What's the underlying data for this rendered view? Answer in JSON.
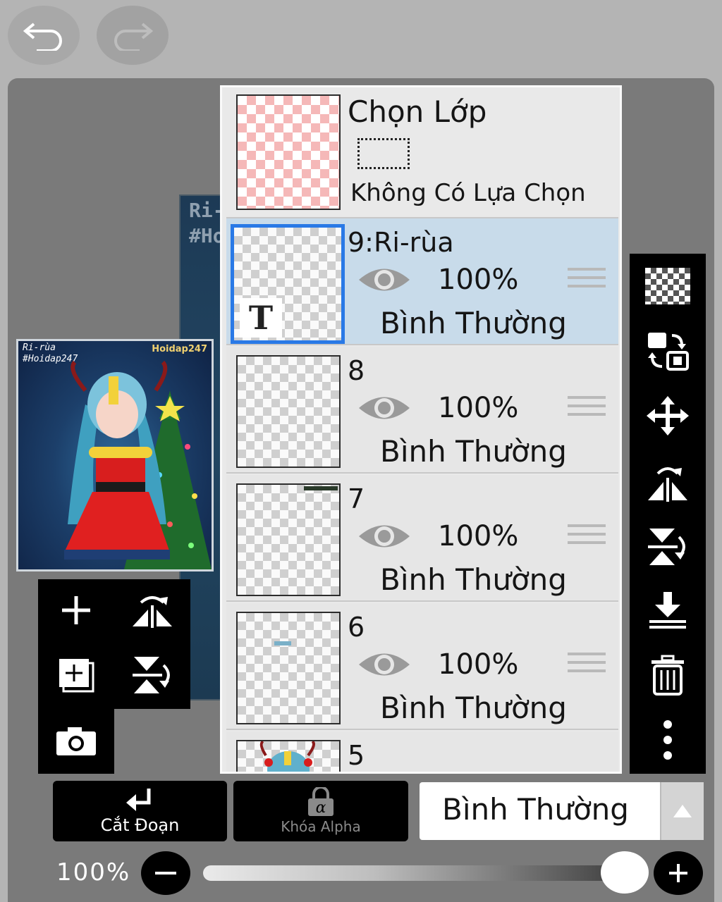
{
  "layer_panel": {
    "selection": {
      "title": "Chọn Lớp",
      "status": "Không Có Lựa Chọn"
    },
    "layers": [
      {
        "name": "9:Ri-rùa",
        "opacity": "100%",
        "blend": "Bình Thường",
        "selected": true,
        "thumb_icon": "T"
      },
      {
        "name": "8",
        "opacity": "100%",
        "blend": "Bình Thường",
        "selected": false
      },
      {
        "name": "7",
        "opacity": "100%",
        "blend": "Bình Thường",
        "selected": false
      },
      {
        "name": "6",
        "opacity": "100%",
        "blend": "Bình Thường",
        "selected": false
      },
      {
        "name": "5"
      }
    ]
  },
  "preview": {
    "text_line1": "Ri-rùa",
    "text_line2": "#Hoidap247",
    "logo": "Hoidap247"
  },
  "canvas_watermark": {
    "line1": "Ri-",
    "line2": "#Ho"
  },
  "bottom_bar": {
    "clip_label": "Cắt Đoạn",
    "alpha_lock_label": "Khóa Alpha",
    "blend_mode": "Bình Thường",
    "opacity_label": "100%",
    "opacity_value": 1.0
  },
  "colors": {
    "selected_row": "#c8dbea",
    "selection_border": "#2979e6",
    "toolbar": "#000000"
  },
  "icons": {
    "top": [
      "undo-icon",
      "redo-icon"
    ],
    "left_tools": [
      "add-layer-icon",
      "flip-horizontal-icon",
      "add-copy-layer-icon",
      "flip-vertical-icon",
      "camera-icon"
    ],
    "right_tools": [
      "transparency-icon",
      "swap-layer-icon",
      "move-icon",
      "flip-horizontal-icon",
      "flip-vertical-icon",
      "merge-down-icon",
      "trash-icon",
      "more-icon"
    ]
  }
}
